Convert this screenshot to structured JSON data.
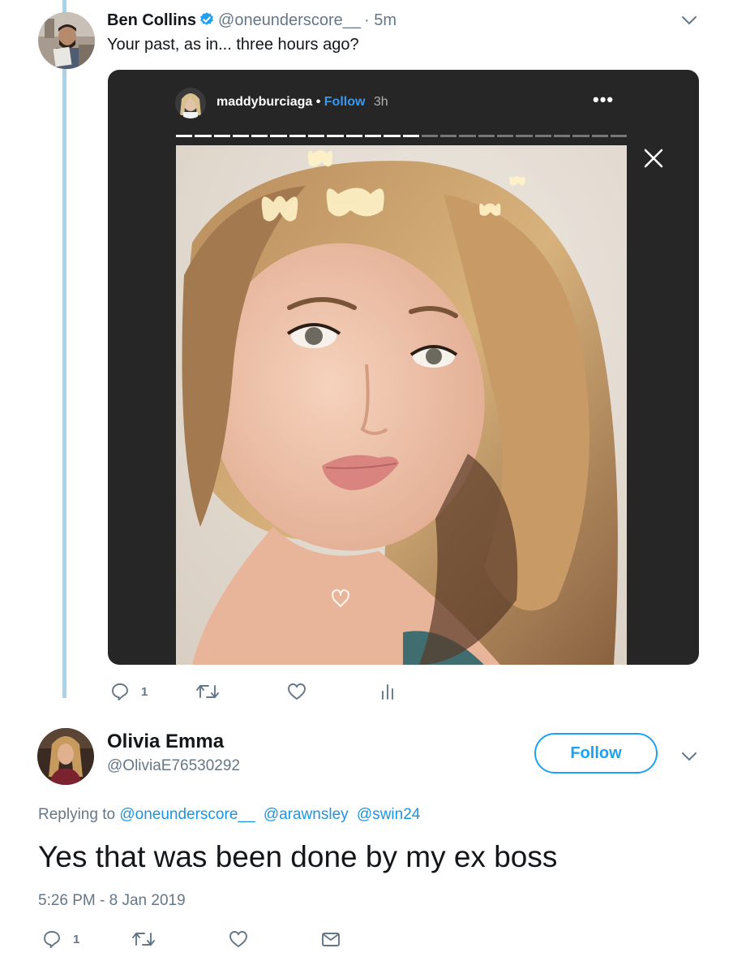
{
  "tweet1": {
    "name": "Ben Collins",
    "handle": "@oneunderscore__",
    "time": "· 5m",
    "text": "Your past, as in... three hours ago?",
    "story": {
      "username": "maddyburciaga",
      "separator": "•",
      "follow": "Follow",
      "time": "3h",
      "menu": "•••",
      "progress_fraction": 0.58
    },
    "actions": {
      "reply_count": "1"
    }
  },
  "tweet2": {
    "name": "Olivia Emma",
    "handle": "@OliviaE76530292",
    "follow_label": "Follow",
    "replying_prefix": "Replying to",
    "mentions": [
      "@oneunderscore__",
      "@arawnsley",
      "@swin24"
    ],
    "text": "Yes that was been done by my ex boss",
    "timestamp": "5:26 PM - 8 Jan 2019",
    "actions": {
      "reply_count": "1"
    }
  },
  "colors": {
    "accent": "#1da1f2",
    "thread_line": "#a8d3ea",
    "muted": "#657786",
    "instagram_blue": "#3897f0"
  }
}
